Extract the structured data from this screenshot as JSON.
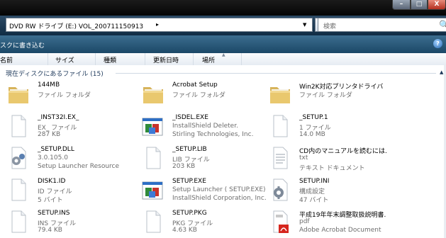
{
  "window": {
    "minimize_symbol": "–",
    "maximize_symbol": "□",
    "close_symbol": "X"
  },
  "address": {
    "path": "DVD RW ドライブ (E:) VOL_200711150913",
    "arrow": "▸",
    "dropdown": "▼"
  },
  "refresh_symbol": "⟳",
  "search": {
    "placeholder": "検索",
    "icon_glyph": "🔍"
  },
  "toolbar": {
    "burn_label": "スクに書き込む",
    "help_symbol": "?"
  },
  "columns": [
    {
      "label": "名前"
    },
    {
      "label": "サイズ"
    },
    {
      "label": "種類"
    },
    {
      "label": "更新日時"
    },
    {
      "label": "場所"
    }
  ],
  "group": {
    "label": "現在ディスクにあるファイル (15)",
    "collapse_symbol": "▲"
  },
  "files": [
    {
      "name": "144MB",
      "line2": "ファイル フォルダ",
      "line3": "",
      "icon": "folder-icon"
    },
    {
      "name": "Acrobat Setup",
      "line2": "ファイル フォルダ",
      "line3": "",
      "icon": "folder-icon"
    },
    {
      "name": "Win2K対応プリンタドライバ",
      "line2": "ファイル フォルダ",
      "line3": "",
      "icon": "folder-icon"
    },
    {
      "name": "_INST32I.EX_",
      "line2": "EX_ ファイル",
      "line3": "287 KB",
      "icon": "file-icon"
    },
    {
      "name": "_ISDEL.EXE",
      "line2": "InstallShield Deleter.",
      "line3": "Stirling Technologies, Inc.",
      "icon": "installer-icon"
    },
    {
      "name": "_SETUP.1",
      "line2": "1 ファイル",
      "line3": "14.0 MB",
      "icon": "file-icon"
    },
    {
      "name": "_SETUP.DLL",
      "line2": "3.0.105.0",
      "line3": "Setup Launcher Resource",
      "icon": "dll-icon"
    },
    {
      "name": "_SETUP.LIB",
      "line2": "LIB ファイル",
      "line3": "203 KB",
      "icon": "file-icon"
    },
    {
      "name": "CD内のマニュアルを読むには.",
      "line2": "txt",
      "line3": "テキスト ドキュメント",
      "icon": "text-document-icon"
    },
    {
      "name": "DISK1.ID",
      "line2": "ID ファイル",
      "line3": "5 バイト",
      "icon": "file-icon"
    },
    {
      "name": "SETUP.EXE",
      "line2": "Setup Launcher ( SETUP.EXE)",
      "line3": "InstallShield Corporation, Inc.",
      "icon": "installer-icon"
    },
    {
      "name": "SETUP.INI",
      "line2": "構成設定",
      "line3": "47 バイト",
      "icon": "settings-file-icon"
    },
    {
      "name": "SETUP.INS",
      "line2": "INS ファイル",
      "line3": "79.4 KB",
      "icon": "file-icon"
    },
    {
      "name": "SETUP.PKG",
      "line2": "PKG ファイル",
      "line3": "4.63 KB",
      "icon": "file-icon"
    },
    {
      "name": "平成19年年末調整取扱説明書.",
      "line2": "pdf",
      "line3": "Adobe Acrobat Document",
      "icon": "pdf-icon"
    }
  ]
}
